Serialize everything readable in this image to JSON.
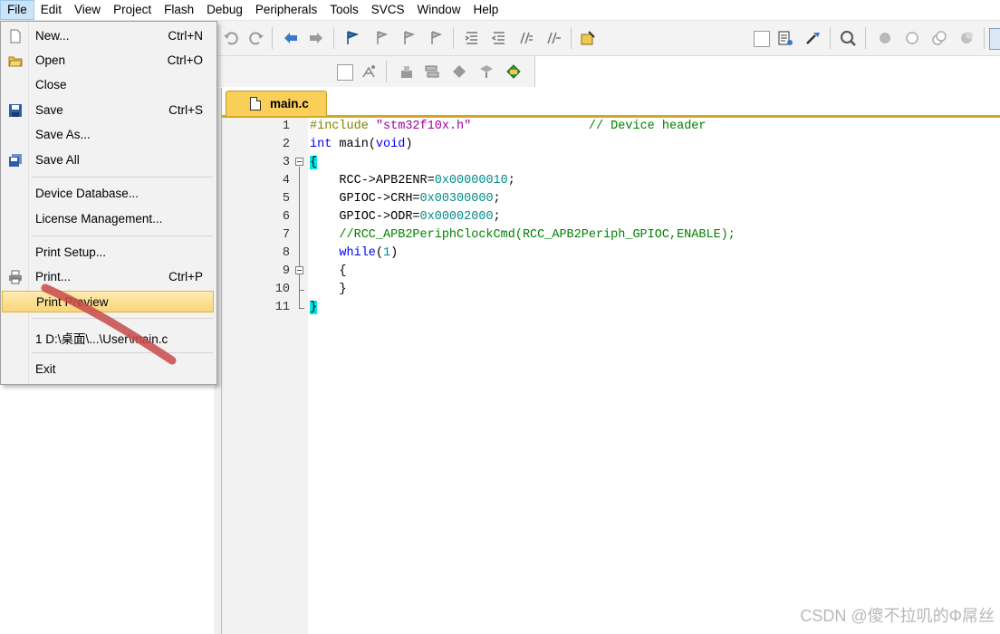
{
  "menubar": {
    "items": [
      "File",
      "Edit",
      "View",
      "Project",
      "Flash",
      "Debug",
      "Peripherals",
      "Tools",
      "SVCS",
      "Window",
      "Help"
    ]
  },
  "file_menu": {
    "items": [
      {
        "label": "New...",
        "shortcut": "Ctrl+N",
        "icon": "new-file-icon"
      },
      {
        "label": "Open",
        "shortcut": "Ctrl+O",
        "icon": "open-folder-icon"
      },
      {
        "label": "Close",
        "shortcut": ""
      },
      {
        "label": "Save",
        "shortcut": "Ctrl+S",
        "icon": "save-icon"
      },
      {
        "label": "Save As...",
        "shortcut": ""
      },
      {
        "label": "Save All",
        "shortcut": "",
        "icon": "save-all-icon"
      },
      {
        "label": "Device Database...",
        "shortcut": ""
      },
      {
        "label": "License Management...",
        "shortcut": ""
      },
      {
        "label": "Print Setup...",
        "shortcut": ""
      },
      {
        "label": "Print...",
        "shortcut": "Ctrl+P",
        "icon": "printer-icon"
      },
      {
        "label": "Print Preview",
        "shortcut": ""
      },
      {
        "label": "1 D:\\桌面\\...\\User\\main.c",
        "shortcut": ""
      },
      {
        "label": "Exit",
        "shortcut": ""
      }
    ],
    "highlighted": "Print Preview"
  },
  "editor": {
    "tab_label": "main.c",
    "lines": [
      {
        "n": "1",
        "parts": [
          [
            "pre",
            "#include "
          ],
          [
            "str",
            "\"stm32f10x.h\""
          ],
          [
            "def",
            "                "
          ],
          [
            "cmt",
            "// Device header"
          ]
        ]
      },
      {
        "n": "2",
        "parts": [
          [
            "kw",
            "int"
          ],
          [
            "def",
            " main("
          ],
          [
            "kw",
            "void"
          ],
          [
            "def",
            ")"
          ]
        ]
      },
      {
        "n": "3",
        "parts": [
          [
            "brace",
            "{"
          ]
        ]
      },
      {
        "n": "4",
        "parts": [
          [
            "def",
            "    RCC->APB2ENR="
          ],
          [
            "num",
            "0x00000010"
          ],
          [
            "def",
            ";"
          ]
        ]
      },
      {
        "n": "5",
        "parts": [
          [
            "def",
            "    GPIOC->CRH="
          ],
          [
            "num",
            "0x00300000"
          ],
          [
            "def",
            ";"
          ]
        ]
      },
      {
        "n": "6",
        "parts": [
          [
            "def",
            "    GPIOC->ODR="
          ],
          [
            "num",
            "0x00002000"
          ],
          [
            "def",
            ";"
          ]
        ]
      },
      {
        "n": "7",
        "parts": [
          [
            "cmt",
            "    //RCC_APB2PeriphClockCmd(RCC_APB2Periph_GPIOC,ENABLE);"
          ]
        ]
      },
      {
        "n": "8",
        "parts": [
          [
            "kw",
            "    while"
          ],
          [
            "def",
            "("
          ],
          [
            "num",
            "1"
          ],
          [
            "def",
            ")"
          ]
        ]
      },
      {
        "n": "9",
        "parts": [
          [
            "def",
            "    {"
          ]
        ]
      },
      {
        "n": "10",
        "parts": [
          [
            "def",
            "    }"
          ]
        ]
      },
      {
        "n": "11",
        "parts": [
          [
            "brace",
            "}"
          ]
        ]
      }
    ]
  },
  "watermark": "CSDN @傻不拉叽的Φ屌丝",
  "colors": {
    "tab": "#f9cf5a",
    "highlight": "#f8d67a",
    "annotation": "#c84a4a"
  }
}
